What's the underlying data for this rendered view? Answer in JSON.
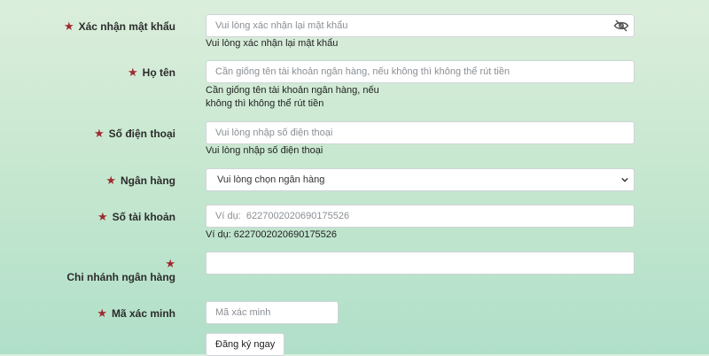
{
  "fields": {
    "confirm_password": {
      "label": "Xác nhận mật khẩu",
      "placeholder": "Vui lòng xác nhận lại mật khẩu",
      "hint": "Vui lòng xác nhận lại mật khẩu"
    },
    "full_name": {
      "label": "Họ tên",
      "placeholder": "Cần giống tên tài khoản ngân hàng, nếu không thì không thể rút tiền",
      "hint_line1": "Cần giống tên tài khoản ngân hàng, nếu",
      "hint_line2": "không thì không thể rút tiền"
    },
    "phone": {
      "label": "Số điện thoại",
      "placeholder": "Vui lòng nhập số điện thoại",
      "hint": "Vui lòng nhập số điện thoại"
    },
    "bank": {
      "label": "Ngân hàng",
      "selected": "Vui lòng chọn ngân hàng"
    },
    "account_number": {
      "label": "Số tài khoản",
      "placeholder": "Ví dụ:  6227002020690175526",
      "hint": "Ví dụ:  6227002020690175526"
    },
    "branch": {
      "label": "Chi nhánh ngân hàng",
      "placeholder": ""
    },
    "captcha": {
      "label": "Mã xác minh",
      "placeholder": "Mã xác minh"
    }
  },
  "required_marker": "★",
  "submit_label": "Đăng ký ngay",
  "colors": {
    "star": "#9e2a2f",
    "input_border": "#cfd4d9"
  },
  "icons": {
    "password_toggle": "eye-slash-icon",
    "select_arrow": "chevron-down-icon"
  }
}
